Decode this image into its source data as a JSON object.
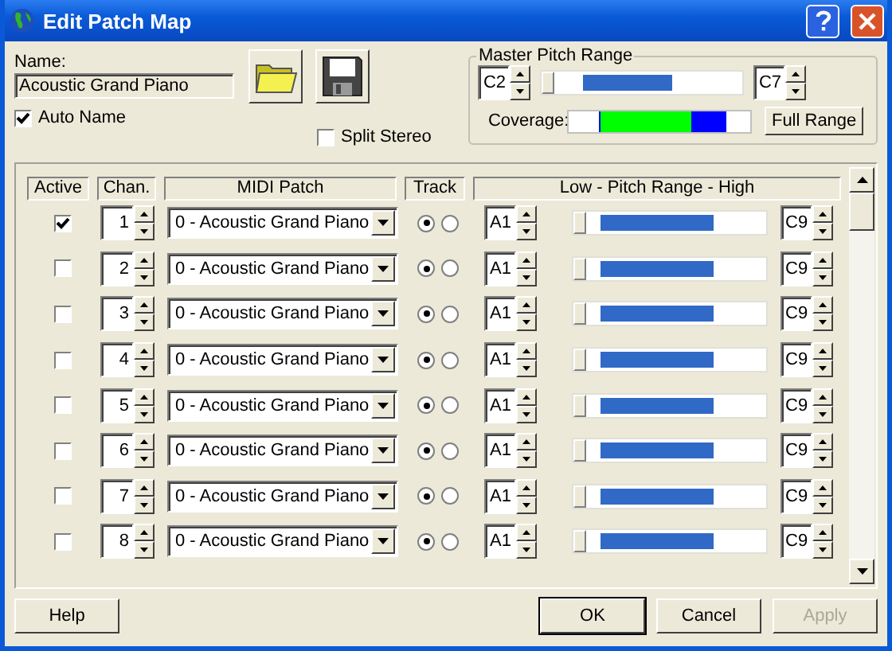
{
  "window": {
    "title": "Edit Patch Map"
  },
  "name": {
    "label": "Name:",
    "value": "Acoustic Grand Piano"
  },
  "auto_name": {
    "label": "Auto Name",
    "checked": true
  },
  "split_stereo": {
    "label": "Split Stereo",
    "checked": false
  },
  "master_pitch_range": {
    "title": "Master Pitch Range",
    "low": "C2",
    "high": "C7",
    "level": 0.56,
    "coverage_label": "Coverage:",
    "full_range_button": "Full Range"
  },
  "columns": [
    "Active",
    "Chan.",
    "MIDI Patch",
    "Track",
    "Low - Pitch Range - High"
  ],
  "rows": [
    {
      "active": true,
      "channel": "1",
      "patch": "0 - Acoustic Grand Piano",
      "track": [
        {
          "selected": true
        },
        {
          "selected": false
        }
      ],
      "low": "A1",
      "high": "C9",
      "level": 0.68
    },
    {
      "active": false,
      "channel": "2",
      "patch": "0 - Acoustic Grand Piano",
      "track": [
        {
          "selected": true
        },
        {
          "selected": false
        }
      ],
      "low": "A1",
      "high": "C9",
      "level": 0.68
    },
    {
      "active": false,
      "channel": "3",
      "patch": "0 - Acoustic Grand Piano",
      "track": [
        {
          "selected": true
        },
        {
          "selected": false
        }
      ],
      "low": "A1",
      "high": "C9",
      "level": 0.68
    },
    {
      "active": false,
      "channel": "4",
      "patch": "0 - Acoustic Grand Piano",
      "track": [
        {
          "selected": true
        },
        {
          "selected": false
        }
      ],
      "low": "A1",
      "high": "C9",
      "level": 0.68
    },
    {
      "active": false,
      "channel": "5",
      "patch": "0 - Acoustic Grand Piano",
      "track": [
        {
          "selected": true
        },
        {
          "selected": false
        }
      ],
      "low": "A1",
      "high": "C9",
      "level": 0.68
    },
    {
      "active": false,
      "channel": "6",
      "patch": "0 - Acoustic Grand Piano",
      "track": [
        {
          "selected": true
        },
        {
          "selected": false
        }
      ],
      "low": "A1",
      "high": "C9",
      "level": 0.68
    },
    {
      "active": false,
      "channel": "7",
      "patch": "0 - Acoustic Grand Piano",
      "track": [
        {
          "selected": true
        },
        {
          "selected": false
        }
      ],
      "low": "A1",
      "high": "C9",
      "level": 0.68
    },
    {
      "active": false,
      "channel": "8",
      "patch": "0 - Acoustic Grand Piano",
      "track": [
        {
          "selected": true
        },
        {
          "selected": false
        }
      ],
      "low": "A1",
      "high": "C9",
      "level": 0.68
    }
  ],
  "buttons": [
    {
      "label": "Help",
      "disabled": false
    },
    {
      "label": "OK",
      "disabled": false
    },
    {
      "label": "Cancel",
      "disabled": false
    },
    {
      "label": "Apply",
      "disabled": true
    }
  ]
}
